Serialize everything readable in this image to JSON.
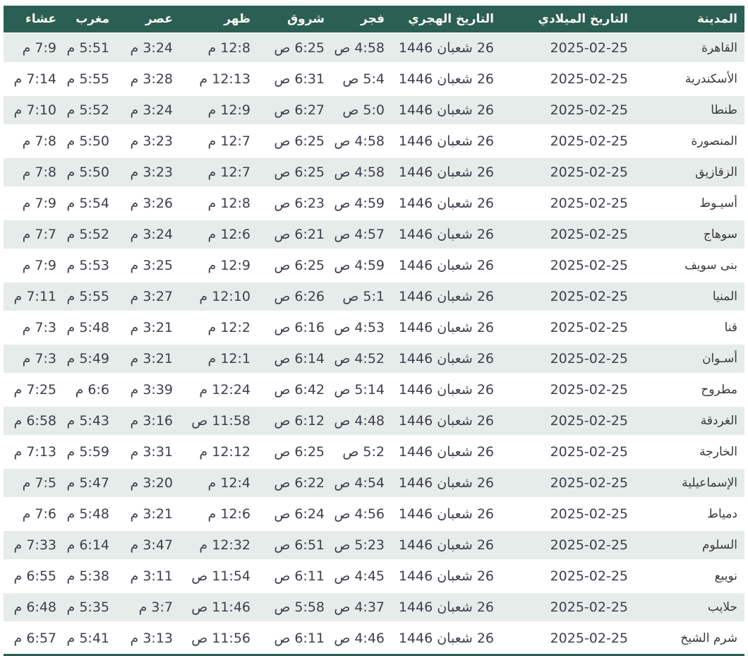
{
  "colors": {
    "header_bg": "#2b5f53",
    "header_text": "#fbfaf4",
    "row_alt_bg": "#e6ecea",
    "row_bg": "#ffffff",
    "cell_text": "#3f3f4b",
    "bottom_border": "#2b5f53"
  },
  "table": {
    "columns": [
      {
        "key": "city",
        "label": "المدينة"
      },
      {
        "key": "gregorian",
        "label": "التاريخ الميلادي"
      },
      {
        "key": "hijri",
        "label": "التاريخ الهجري"
      },
      {
        "key": "fajr",
        "label": "فجر"
      },
      {
        "key": "sunrise",
        "label": "شروق"
      },
      {
        "key": "dhuhr",
        "label": "ظهر"
      },
      {
        "key": "asr",
        "label": "عصر"
      },
      {
        "key": "maghrib",
        "label": "مغرب"
      },
      {
        "key": "isha",
        "label": "عشاء"
      }
    ],
    "rows": [
      {
        "city": "القاهرة",
        "gregorian": "2025-02-25",
        "hijri": "26 شعبان 1446",
        "fajr": "4:58 ص",
        "sunrise": "6:25 ص",
        "dhuhr": "12:8 م",
        "asr": "3:24 م",
        "maghrib": "5:51 م",
        "isha": "7:9 م"
      },
      {
        "city": "الأسكندرية",
        "gregorian": "2025-02-25",
        "hijri": "26 شعبان 1446",
        "fajr": "5:4 ص",
        "sunrise": "6:31 ص",
        "dhuhr": "12:13 م",
        "asr": "3:28 م",
        "maghrib": "5:55 م",
        "isha": "7:14 م"
      },
      {
        "city": "طنطا",
        "gregorian": "2025-02-25",
        "hijri": "26 شعبان 1446",
        "fajr": "5:0 ص",
        "sunrise": "6:27 ص",
        "dhuhr": "12:9 م",
        "asr": "3:24 م",
        "maghrib": "5:52 م",
        "isha": "7:10 م"
      },
      {
        "city": "المنصورة",
        "gregorian": "2025-02-25",
        "hijri": "26 شعبان 1446",
        "fajr": "4:58 ص",
        "sunrise": "6:25 ص",
        "dhuhr": "12:7 م",
        "asr": "3:23 م",
        "maghrib": "5:50 م",
        "isha": "7:8 م"
      },
      {
        "city": "الزقازيق",
        "gregorian": "2025-02-25",
        "hijri": "26 شعبان 1446",
        "fajr": "4:58 ص",
        "sunrise": "6:25 ص",
        "dhuhr": "12:7 م",
        "asr": "3:23 م",
        "maghrib": "5:50 م",
        "isha": "7:8 م"
      },
      {
        "city": "أسيـوط",
        "gregorian": "2025-02-25",
        "hijri": "26 شعبان 1446",
        "fajr": "4:59 ص",
        "sunrise": "6:23 ص",
        "dhuhr": "12:8 م",
        "asr": "3:26 م",
        "maghrib": "5:54 م",
        "isha": "7:9 م"
      },
      {
        "city": "سوهاج",
        "gregorian": "2025-02-25",
        "hijri": "26 شعبان 1446",
        "fajr": "4:57 ص",
        "sunrise": "6:21 ص",
        "dhuhr": "12:6 م",
        "asr": "3:24 م",
        "maghrib": "5:52 م",
        "isha": "7:7 م"
      },
      {
        "city": "بنى سويف",
        "gregorian": "2025-02-25",
        "hijri": "26 شعبان 1446",
        "fajr": "4:59 ص",
        "sunrise": "6:25 ص",
        "dhuhr": "12:9 م",
        "asr": "3:25 م",
        "maghrib": "5:53 م",
        "isha": "7:9 م"
      },
      {
        "city": "المنيا",
        "gregorian": "2025-02-25",
        "hijri": "26 شعبان 1446",
        "fajr": "5:1 ص",
        "sunrise": "6:26 ص",
        "dhuhr": "12:10 م",
        "asr": "3:27 م",
        "maghrib": "5:55 م",
        "isha": "7:11 م"
      },
      {
        "city": "قنا",
        "gregorian": "2025-02-25",
        "hijri": "26 شعبان 1446",
        "fajr": "4:53 ص",
        "sunrise": "6:16 ص",
        "dhuhr": "12:2 م",
        "asr": "3:21 م",
        "maghrib": "5:48 م",
        "isha": "7:3 م"
      },
      {
        "city": "أسـوان",
        "gregorian": "2025-02-25",
        "hijri": "26 شعبان 1446",
        "fajr": "4:52 ص",
        "sunrise": "6:14 ص",
        "dhuhr": "12:1 م",
        "asr": "3:21 م",
        "maghrib": "5:49 م",
        "isha": "7:3 م"
      },
      {
        "city": "مطروح",
        "gregorian": "2025-02-25",
        "hijri": "26 شعبان 1446",
        "fajr": "5:14 ص",
        "sunrise": "6:42 ص",
        "dhuhr": "12:24 م",
        "asr": "3:39 م",
        "maghrib": "6:6 م",
        "isha": "7:25 م"
      },
      {
        "city": "الغردقة",
        "gregorian": "2025-02-25",
        "hijri": "26 شعبان 1446",
        "fajr": "4:48 ص",
        "sunrise": "6:12 ص",
        "dhuhr": "11:58 ص",
        "asr": "3:16 م",
        "maghrib": "5:43 م",
        "isha": "6:58 م"
      },
      {
        "city": "الخارجة",
        "gregorian": "2025-02-25",
        "hijri": "26 شعبان 1446",
        "fajr": "5:2 ص",
        "sunrise": "6:25 ص",
        "dhuhr": "12:12 م",
        "asr": "3:31 م",
        "maghrib": "5:59 م",
        "isha": "7:13 م"
      },
      {
        "city": "الإسماعيلية",
        "gregorian": "2025-02-25",
        "hijri": "26 شعبان 1446",
        "fajr": "4:54 ص",
        "sunrise": "6:22 ص",
        "dhuhr": "12:4 م",
        "asr": "3:20 م",
        "maghrib": "5:47 م",
        "isha": "7:5 م"
      },
      {
        "city": "دمياط",
        "gregorian": "2025-02-25",
        "hijri": "26 شعبان 1446",
        "fajr": "4:56 ص",
        "sunrise": "6:24 ص",
        "dhuhr": "12:6 م",
        "asr": "3:21 م",
        "maghrib": "5:48 م",
        "isha": "7:6 م"
      },
      {
        "city": "السلوم",
        "gregorian": "2025-02-25",
        "hijri": "26 شعبان 1446",
        "fajr": "5:23 ص",
        "sunrise": "6:51 ص",
        "dhuhr": "12:32 م",
        "asr": "3:47 م",
        "maghrib": "6:14 م",
        "isha": "7:33 م"
      },
      {
        "city": "نويبع",
        "gregorian": "2025-02-25",
        "hijri": "26 شعبان 1446",
        "fajr": "4:45 ص",
        "sunrise": "6:11 ص",
        "dhuhr": "11:54 ص",
        "asr": "3:11 م",
        "maghrib": "5:38 م",
        "isha": "6:55 م"
      },
      {
        "city": "حلايب",
        "gregorian": "2025-02-25",
        "hijri": "26 شعبان 1446",
        "fajr": "4:37 ص",
        "sunrise": "5:58 ص",
        "dhuhr": "11:46 ص",
        "asr": "3:7 م",
        "maghrib": "5:35 م",
        "isha": "6:48 م"
      },
      {
        "city": "شرم الشيخ",
        "gregorian": "2025-02-25",
        "hijri": "26 شعبان 1446",
        "fajr": "4:46 ص",
        "sunrise": "6:11 ص",
        "dhuhr": "11:56 ص",
        "asr": "3:13 م",
        "maghrib": "5:41 م",
        "isha": "6:57 م"
      }
    ]
  }
}
